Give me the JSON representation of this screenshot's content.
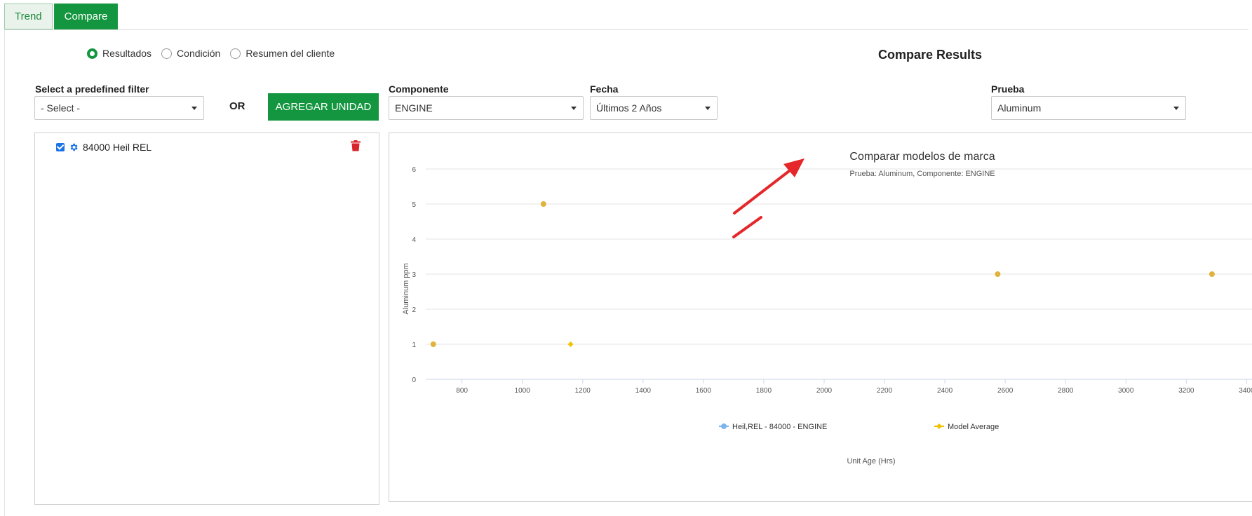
{
  "tabs": [
    {
      "label": "Trend",
      "active": false
    },
    {
      "label": "Compare",
      "active": true
    }
  ],
  "view_options": {
    "selected": "Resultados",
    "items": [
      "Resultados",
      "Condición",
      "Resumen del cliente"
    ]
  },
  "page_title": "Compare Results",
  "filters": {
    "predefined_label": "Select a predefined filter",
    "predefined_value": "- Select -",
    "or_text": "OR",
    "add_unit_label": "AGREGAR UNIDAD",
    "component_label": "Componente",
    "component_value": "ENGINE",
    "date_label": "Fecha",
    "date_value": "Últimos 2 Años",
    "test_label": "Prueba",
    "test_value": "Aluminum"
  },
  "units": [
    {
      "name": "84000 Heil REL",
      "checked": true,
      "icon": "gear-icon",
      "action_icon": "trash-icon"
    }
  ],
  "colors": {
    "brand_green": "#13963f",
    "series_unit": "#7cb5ec",
    "series_average": "#f2c100",
    "trash": "#d9242b",
    "annotation_arrow": "#e5262a"
  },
  "chart_data": {
    "type": "scatter",
    "title": "Comparar modelos de marca",
    "subtitle": "Prueba: Aluminum, Componente: ENGINE",
    "xlabel": "Unit Age (Hrs)",
    "ylabel": "Aluminum ppm",
    "xlim": [
      680,
      3420
    ],
    "ylim": [
      0,
      6
    ],
    "x_ticks": [
      800,
      1000,
      1200,
      1400,
      1600,
      1800,
      2000,
      2200,
      2400,
      2600,
      2800,
      3000,
      3200,
      3400
    ],
    "y_ticks": [
      0,
      1,
      2,
      3,
      4,
      5,
      6
    ],
    "grid": true,
    "legend_position": "bottom",
    "series": [
      {
        "name": "Heil,REL - 84000 - ENGINE",
        "marker": "circle",
        "points": [
          [
            705,
            1
          ],
          [
            1070,
            5
          ],
          [
            2575,
            3
          ],
          [
            3285,
            3
          ]
        ]
      },
      {
        "name": "Model Average",
        "marker": "diamond",
        "points": [
          [
            1160,
            1
          ]
        ]
      }
    ]
  }
}
